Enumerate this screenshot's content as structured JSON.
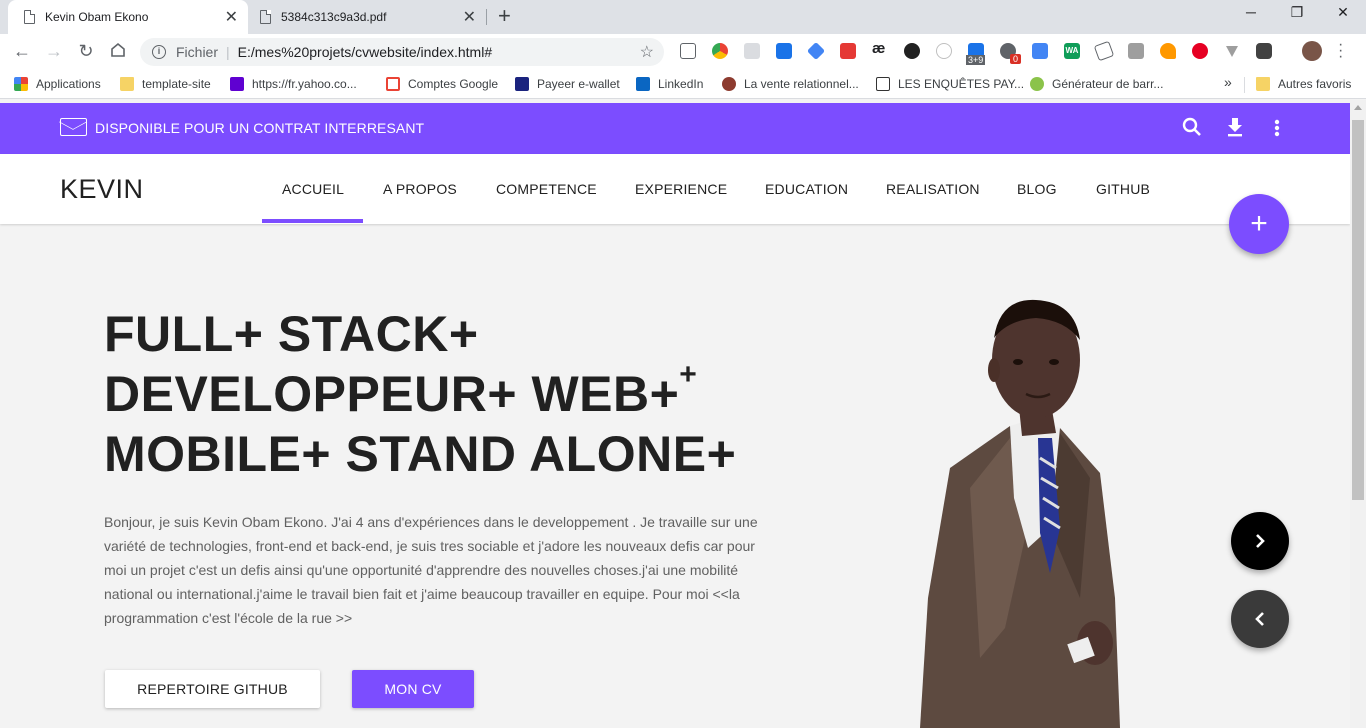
{
  "browser": {
    "tabs": [
      {
        "title": "Kevin Obam Ekono"
      },
      {
        "title": "5384c313c9a3d.pdf"
      }
    ],
    "new_tab": "+",
    "window_controls": {
      "minimize": "─",
      "restore": "❐",
      "close": "✕"
    },
    "omnibox": {
      "scheme": "Fichier",
      "url": "E:/mes%20projets/cvwebsite/index.html#"
    },
    "bookmarks": [
      {
        "label": "Applications",
        "icon": "apps-grid-icon"
      },
      {
        "label": "template-site",
        "icon": "folder-icon"
      },
      {
        "label": "https://fr.yahoo.co...",
        "icon": "yahoo-icon"
      },
      {
        "label": "Comptes Google",
        "icon": "gmail-icon"
      },
      {
        "label": "Payeer e-wallet",
        "icon": "payeer-icon"
      },
      {
        "label": "LinkedIn",
        "icon": "linkedin-icon"
      },
      {
        "label": "La vente relationnel...",
        "icon": "site-icon"
      },
      {
        "label": "LES ENQUÊTES PAY...",
        "icon": "survey-icon"
      },
      {
        "label": "Générateur de barr...",
        "icon": "generator-icon"
      }
    ],
    "bookmarks_more": "»",
    "other_bookmarks": "Autres favoris",
    "ext_badges": {
      "counter": "3+9",
      "zero": "0",
      "ae": "æ",
      "wa": "WA"
    }
  },
  "site": {
    "topbar": {
      "availability": "DISPONIBLE POUR UN CONTRAT INTERRESANT"
    },
    "brand": "KEVIN",
    "nav": [
      "ACCUEIL",
      "A PROPOS",
      "COMPETENCE",
      "EXPERIENCE",
      "EDUCATION",
      "REALISATION",
      "BLOG",
      "GITHUB"
    ],
    "active_nav": "ACCUEIL",
    "fab_add": "+",
    "headline": {
      "line1": "FULL+ STACK+",
      "line2": "DEVELOPPEUR+ WEB+",
      "line2_sup": "+",
      "line3": "MOBILE+ STAND ALONE+"
    },
    "bio": "Bonjour, je suis Kevin Obam Ekono. J'ai 4 ans d'expériences dans le developpement . Je travaille sur une variété de technologies, front-end et back-end, je suis tres sociable et j'adore les nouveaux defis car pour moi un projet c'est un defis ainsi qu'une opportunité d'apprendre des nouvelles choses.j'ai une mobilité national ou international.j'aime le travail bien fait et j'aime beaucoup travailler en equipe. Pour moi <<la programmation c'est l'école de la rue >>",
    "buttons": {
      "github": "REPERTOIRE GITHUB",
      "cv": "MON CV"
    }
  },
  "colors": {
    "accent": "#7c4dff",
    "dark": "#212121",
    "page_bg": "#f3f3f3"
  }
}
